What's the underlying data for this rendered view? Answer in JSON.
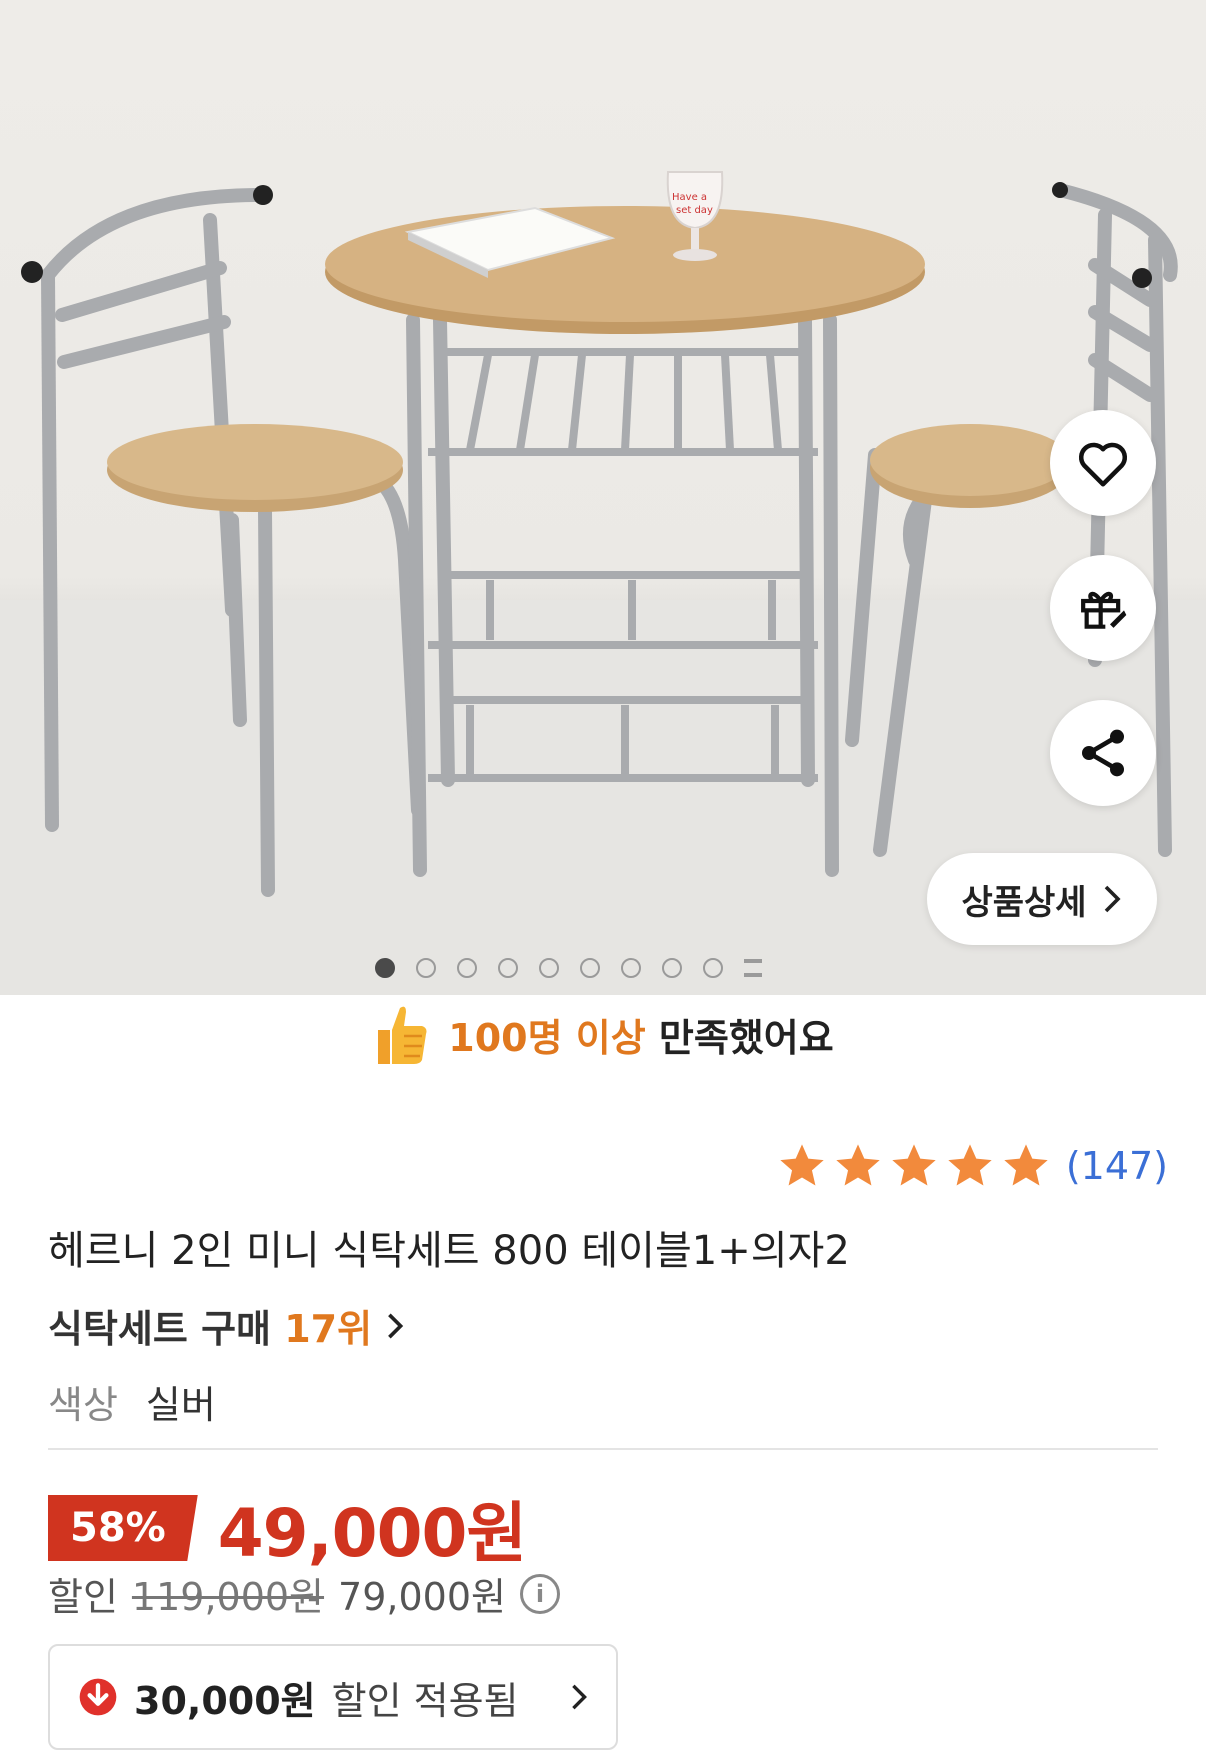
{
  "product_image": {
    "alt": "헤르니 2인 미니 식탁세트",
    "dots_total": 9,
    "dots_active_index": 0
  },
  "actions": {
    "wishlist_icon": "heart-icon",
    "gift_icon": "gift-icon",
    "share_icon": "share-icon",
    "detail_label": "상품상세"
  },
  "satisfaction": {
    "highlight": "100명 이상",
    "text": "만족했어요"
  },
  "rating": {
    "stars": 5,
    "count": "(147)"
  },
  "product": {
    "title": "헤르니 2인 미니 식탁세트 800 테이블1+의자2",
    "rank_prefix": "식탁세트 구매",
    "rank_value": "17위",
    "option_label": "색상",
    "option_value": "실버"
  },
  "price": {
    "discount_rate": "58%",
    "sale_price": "49,000원",
    "discount_label": "할인",
    "original_price": "119,000원",
    "discounted_price": "79,000원"
  },
  "coupon": {
    "amount": "30,000원",
    "text": "할인 적용됨"
  },
  "colors": {
    "accent_red": "#d0341f",
    "accent_orange": "#e0781e",
    "link_blue": "#3b6fd6"
  }
}
